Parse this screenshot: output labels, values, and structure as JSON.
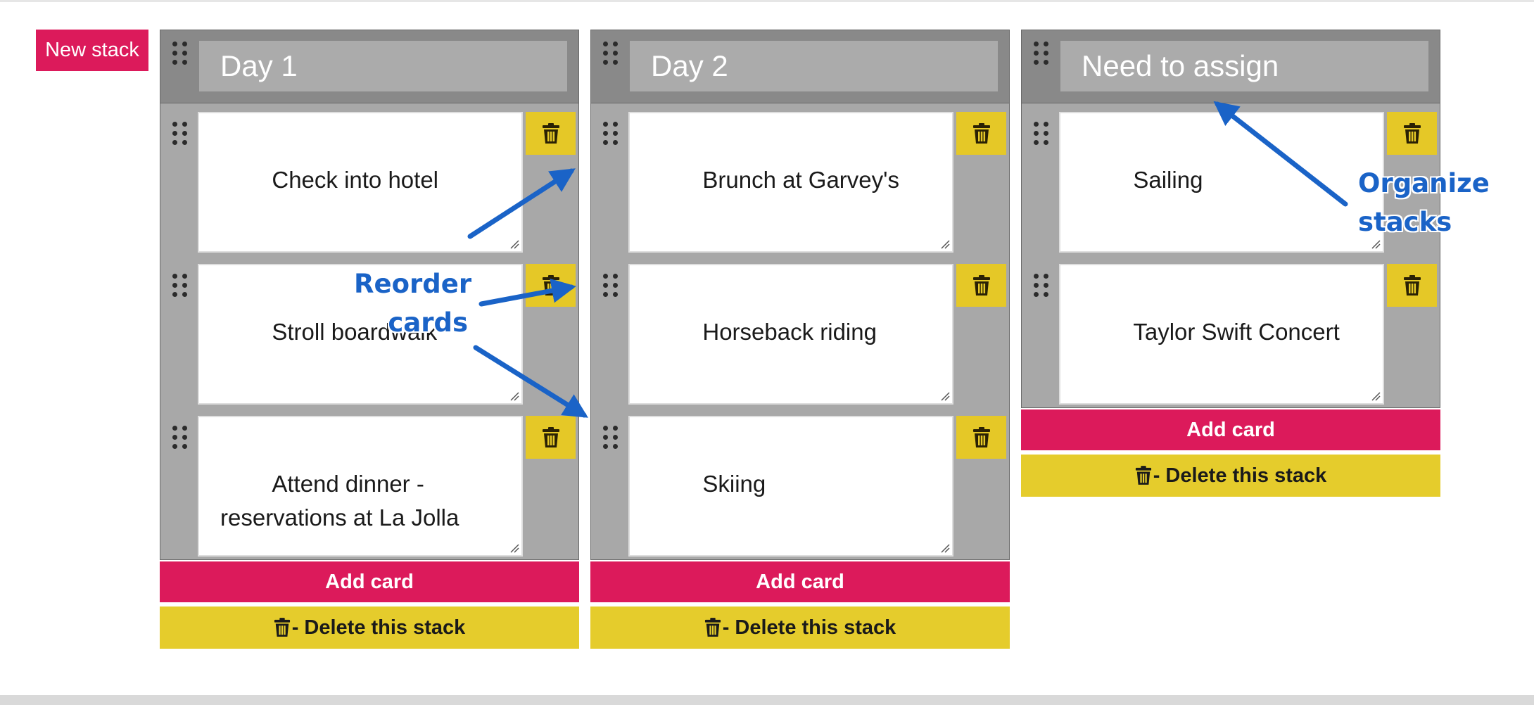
{
  "toolbar": {
    "new_stack_label": "New stack"
  },
  "stacks": [
    {
      "title": "Day 1",
      "cards": [
        {
          "text": "Check into hotel"
        },
        {
          "text": "Stroll boardwalk"
        },
        {
          "text": "Attend dinner - reservations at La Jolla"
        }
      ],
      "add_card_label": "Add card",
      "delete_stack_label": "- Delete this stack"
    },
    {
      "title": "Day 2",
      "cards": [
        {
          "text": "Brunch at Garvey's"
        },
        {
          "text": "Horseback riding"
        },
        {
          "text": "Skiing"
        }
      ],
      "add_card_label": "Add card",
      "delete_stack_label": "- Delete this stack"
    },
    {
      "title": "Need to assign",
      "cards": [
        {
          "text": "Sailing"
        },
        {
          "text": "Taylor Swift Concert"
        }
      ],
      "add_card_label": "Add card",
      "delete_stack_label": "- Delete this stack"
    }
  ],
  "annotations": {
    "reorder_line1": "Reorder",
    "reorder_line2": "cards",
    "organize_line1": "Organize",
    "organize_line2": "stacks"
  },
  "icons": {
    "drag_handle": "drag-handle-icon",
    "trash": "trash-icon",
    "resize": "resize-grip-icon"
  },
  "colors": {
    "accent_pink": "#dc1a5b",
    "accent_yellow": "#e5c827",
    "stack_bg": "#a8a8a8",
    "annotation_blue": "#1a63c7"
  }
}
